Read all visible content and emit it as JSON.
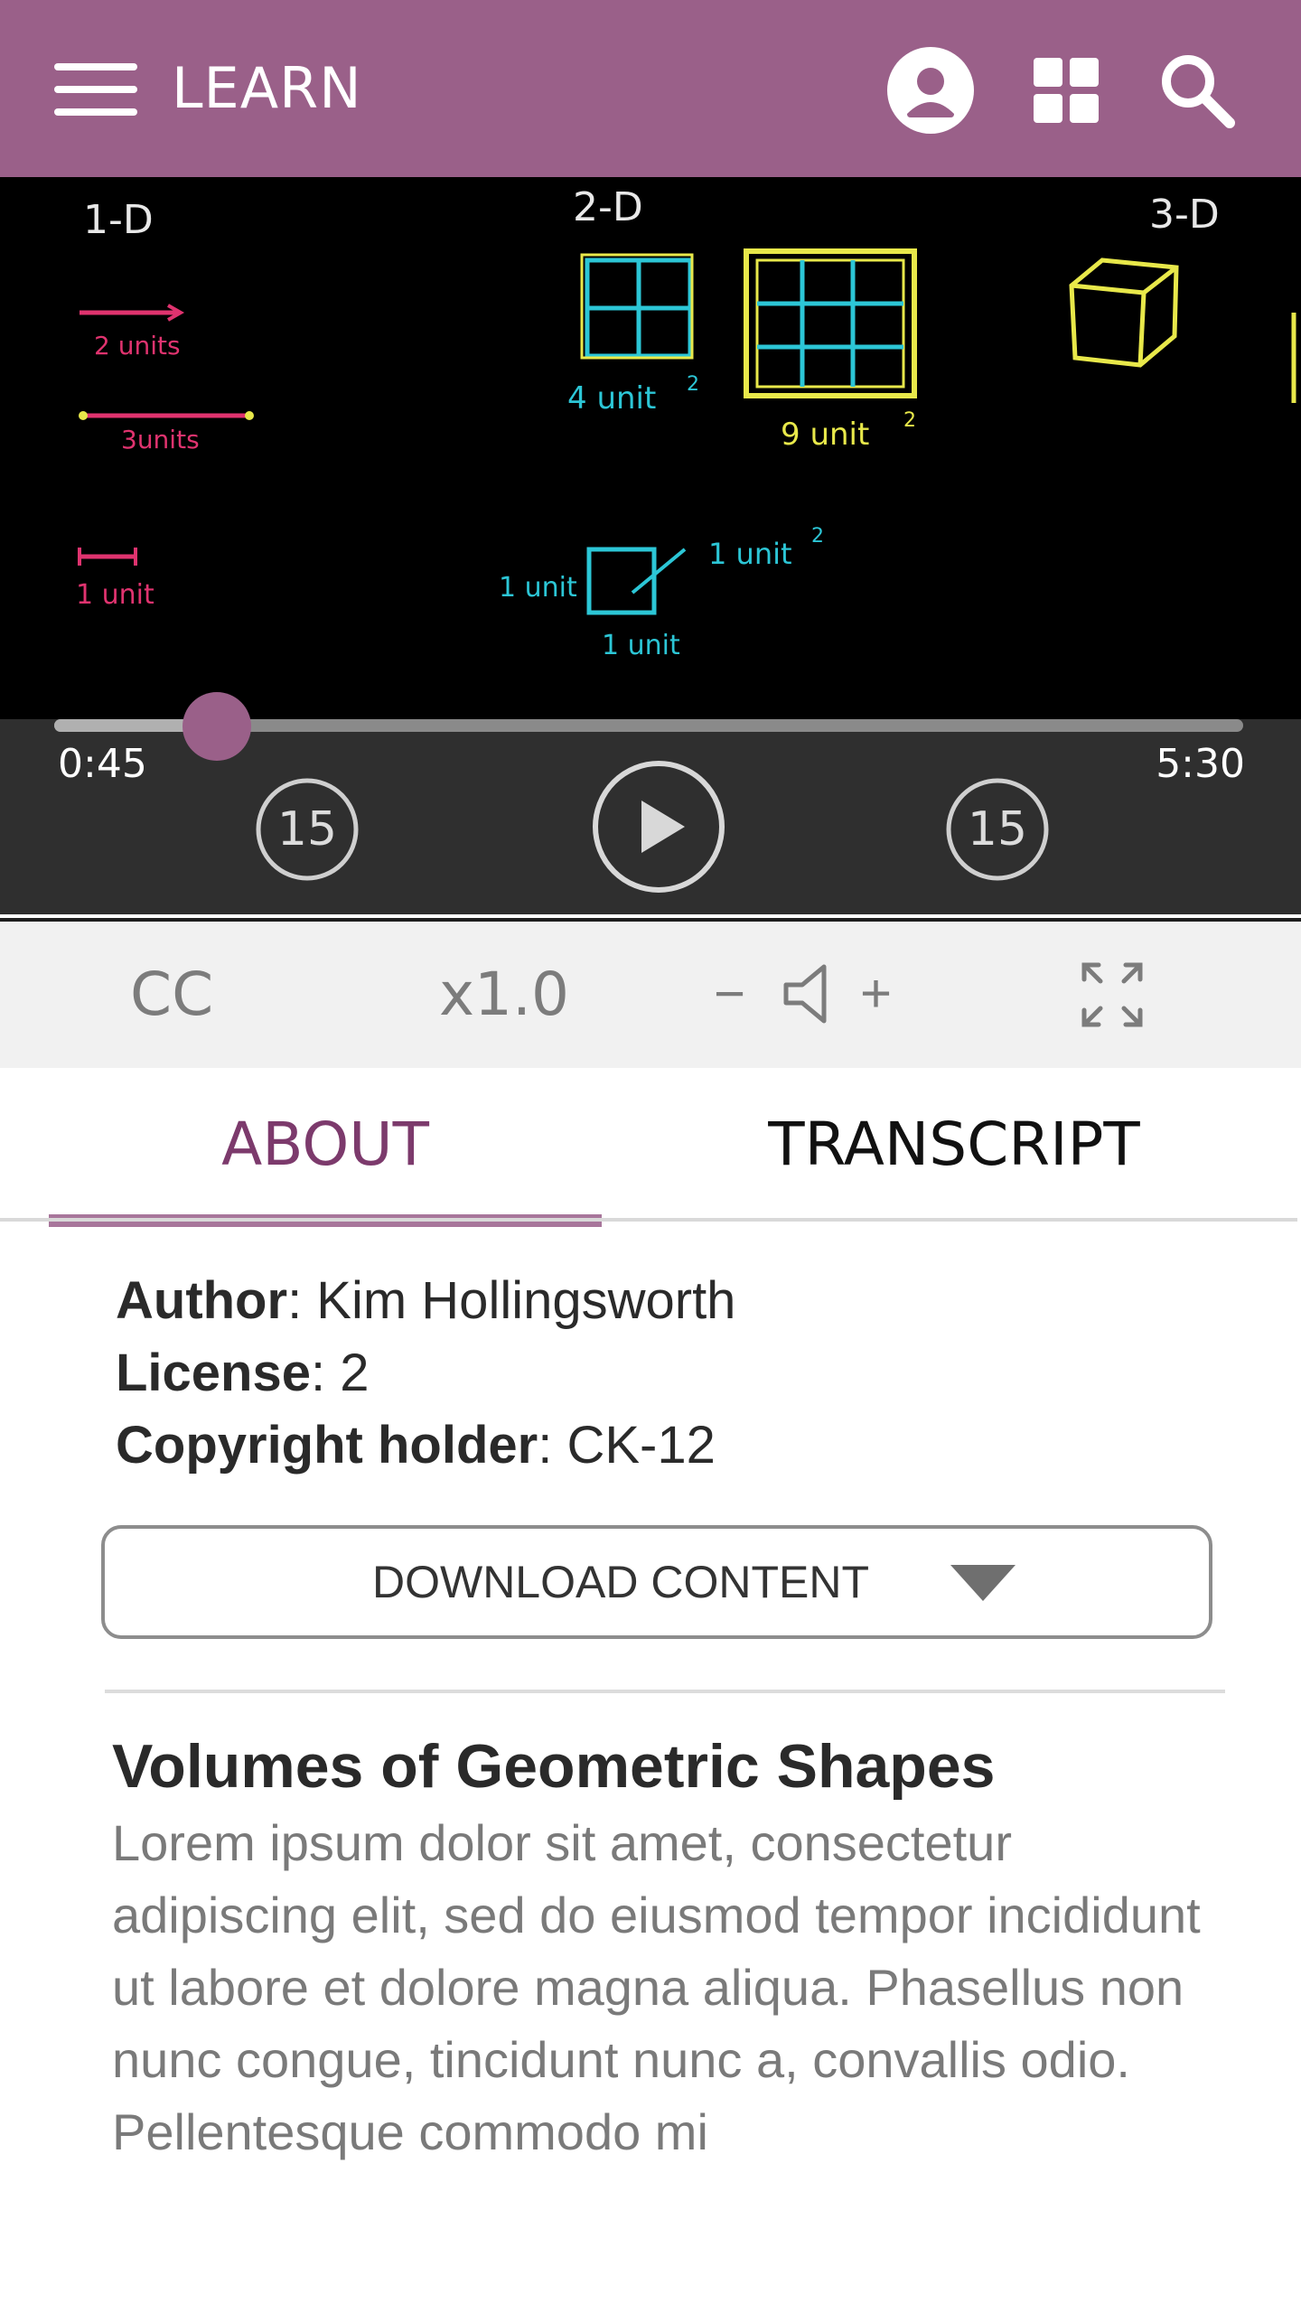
{
  "header": {
    "title": "LEARN",
    "menu_icon": "hamburger-menu-icon",
    "profile_icon": "user-avatar-icon",
    "apps_icon": "grid-apps-icon",
    "search_icon": "search-icon",
    "background_color": "#9a6089"
  },
  "video": {
    "board_labels": {
      "one_d": "1-D",
      "two_d": "2-D",
      "three_d": "3-D",
      "two_units": "2 units",
      "three_units": "3units",
      "one_unit": "1 unit",
      "four_unit_sq": "4 unit",
      "nine_unit_sq": "9 unit",
      "square_side_left": "1 unit",
      "square_side_bottom": "1 unit",
      "square_area": "1 unit",
      "exponent": "2"
    }
  },
  "player": {
    "current_time": "0:45",
    "total_time": "5:30",
    "progress_fraction": 0.1364,
    "rewind_seconds": "15",
    "forward_seconds": "15",
    "play_icon": "play-icon",
    "accent_color": "#9a6089"
  },
  "controls": {
    "cc_label": "CC",
    "speed_label": "x1.0",
    "volume_minus": "−",
    "volume_plus": "+",
    "volume_icon": "speaker-icon",
    "fullscreen_icon": "fullscreen-icon"
  },
  "tabs": [
    {
      "label": "ABOUT",
      "active": true
    },
    {
      "label": "TRANSCRIPT",
      "active": false
    }
  ],
  "about": {
    "author_label": "Author",
    "author_value": "Kim Hollingsworth",
    "license_label": "License",
    "license_value": "2",
    "copyright_label": "Copyright holder",
    "copyright_value": "CK-12",
    "download_label": "DOWNLOAD CONTENT",
    "content_title": "Volumes of Geometric Shapes",
    "content_body": "Lorem ipsum dolor sit amet, consectetur adipiscing elit, sed do eiusmod tempor incididunt ut labore et dolore magna aliqua. Phasellus non nunc congue, tincidunt nunc a, convallis odio. Pellentesque commodo mi"
  }
}
